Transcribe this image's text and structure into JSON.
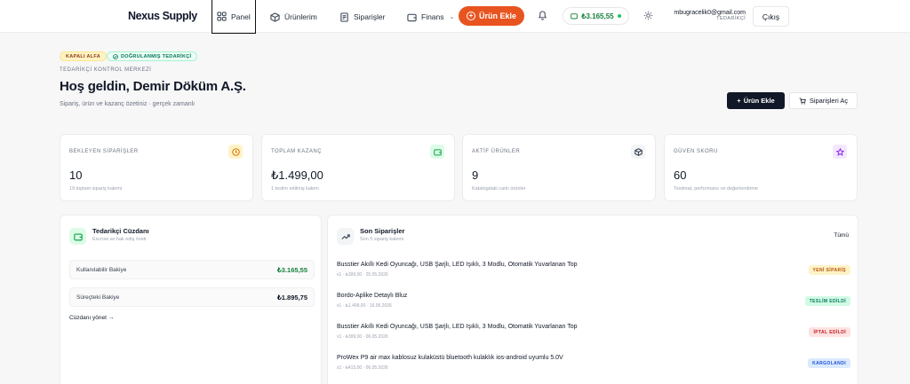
{
  "nav": {
    "brand": "Nexus Supply",
    "links": [
      {
        "label": "Panel",
        "icon": "grid-icon"
      },
      {
        "label": "Ürünlerim",
        "icon": "box-icon"
      },
      {
        "label": "Siparişler",
        "icon": "receipt-icon"
      },
      {
        "label": "Finans",
        "icon": "wallet-icon"
      }
    ],
    "add_product_label": "Ürün Ekle",
    "balance": "₺3.165,55",
    "user_email": "mbugracelik0@gmail.com",
    "user_role": "TEDARİKÇİ",
    "logout_label": "Çıkış"
  },
  "hero": {
    "badge_alpha": "KAPALI ALFA",
    "badge_verified": "DOĞRULANMIŞ TEDARİKÇİ",
    "eyebrow": "TEDARİKÇİ KONTROL MERKEZİ",
    "title": "Hoş geldin, Demir Döküm A.Ş.",
    "subtitle": "Sipariş, ürün ve kazanç özetiniz · gerçek zamanlı",
    "add_product_label": "Ürün Ekle",
    "open_orders_label": "Siparişleri Aç"
  },
  "stats": [
    {
      "label": "BEKLEYEN SİPARİŞLER",
      "value": "10",
      "hint": "19 toplam sipariş kalemi",
      "icon": "clock-icon",
      "color": "#d97706",
      "bg": "#fef3c7"
    },
    {
      "label": "TOPLAM KAZANÇ",
      "value": "₺1.499,00",
      "hint": "1 teslim edilmiş kalem",
      "icon": "wallet-icon",
      "color": "#16a34a",
      "bg": "#dcfce7"
    },
    {
      "label": "AKTİF ÜRÜNLER",
      "value": "9",
      "hint": "Katalogdaki canlı ürünler",
      "icon": "box-icon",
      "color": "#374151",
      "bg": "#f3f4f6"
    },
    {
      "label": "GÜVEN SKORU",
      "value": "60",
      "hint": "Teslimat, performans ve değerlendirme",
      "icon": "star-icon",
      "color": "#9333ea",
      "bg": "#f3e8ff"
    }
  ],
  "wallet": {
    "title": "Tedarikçi Cüzdanı",
    "subtitle": "Escrow ve hak ediş özeti",
    "available_label": "Kullanılabilir Bakiye",
    "available_value": "₺3.165,55",
    "pending_label": "Süreçteki Bakiye",
    "pending_value": "₺1.895,75",
    "manage_label": "Cüzdanı yönet →"
  },
  "orders": {
    "title": "Son Siparişler",
    "subtitle": "Son 5 sipariş kalemi",
    "all_label": "Tümü",
    "items": [
      {
        "title": "Busstier Akıllı Kedi Oyuncağı, USB Şarjlı, LED Işıklı, 3 Modlu, Otomatik Yuvarlanan Top",
        "meta": "x1 · ₺399,00 · 25.05.2026",
        "status": "YENİ SİPARİŞ",
        "fg": "#b45309",
        "bg": "#fef3c7"
      },
      {
        "title": "Bordo-Aplike Detaylı Bluz",
        "meta": "x1 · ₺1.499,00 · 16.05.2026",
        "status": "TESLİM EDİLDİ",
        "fg": "#047857",
        "bg": "#d1fae5"
      },
      {
        "title": "Busstier Akıllı Kedi Oyuncağı, USB Şarjlı, LED Işıklı, 3 Modlu, Otomatik Yuvarlanan Top",
        "meta": "x1 · ₺399,00 · 06.05.2026",
        "status": "İPTAL EDİLDİ",
        "fg": "#b91c1c",
        "bg": "#fee2e2"
      },
      {
        "title": "ProWex P9 air max kablosuz kulaküstü bluetooth kulaklık ios-android uyumlu 5.0V",
        "meta": "x1 · ₺415,00 · 06.05.2026",
        "status": "KARGOLANDI",
        "fg": "#1d4ed8",
        "bg": "#dbeafe"
      }
    ]
  }
}
